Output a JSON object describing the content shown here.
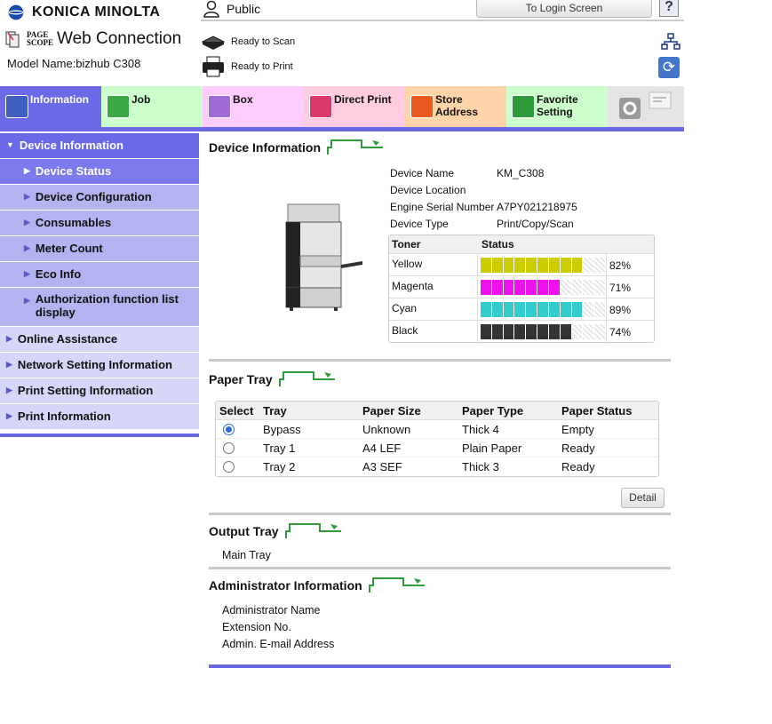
{
  "header": {
    "brand": "KONICA MINOLTA",
    "pagescope_top": "PAGE",
    "pagescope_bottom": "SCOPE",
    "product": "Web Connection",
    "model_label": "Model Name:bizhub C308",
    "user": "Public",
    "login_button": "To Login Screen",
    "help_label": "?",
    "status_scan": "Ready to Scan",
    "status_print": "Ready to Print"
  },
  "tabs": [
    {
      "label": "Information",
      "color": "#6b69e6",
      "icon_color": "#3e5fc0"
    },
    {
      "label": "Job",
      "color": "#ccffcc",
      "icon_color": "#3aa844"
    },
    {
      "label": "Box",
      "color": "#ffccff",
      "icon_color": "#a06ad8"
    },
    {
      "label": "Direct Print",
      "color": "#ffcce0",
      "icon_color": "#d83a6a"
    },
    {
      "label": "Store\nAddress",
      "color": "#ffd4a8",
      "icon_color": "#e85a20"
    },
    {
      "label": "Favorite\nSetting",
      "color": "#ccffcc",
      "icon_color": "#2f9a3a"
    }
  ],
  "sidebar": {
    "device_information": "Device Information",
    "device_status": "Device Status",
    "device_configuration": "Device Configuration",
    "consumables": "Consumables",
    "meter_count": "Meter Count",
    "eco_info": "Eco Info",
    "auth_list": "Authorization function list display",
    "online_assistance": "Online Assistance",
    "network_setting": "Network Setting Information",
    "print_setting": "Print Setting Information",
    "print_information": "Print Information"
  },
  "device_info": {
    "title": "Device Information",
    "rows": [
      {
        "key": "Device Name",
        "value": "KM_C308"
      },
      {
        "key": "Device Location",
        "value": ""
      },
      {
        "key": "Engine Serial Number",
        "value": "A7PY021218975"
      },
      {
        "key": "Device Type",
        "value": "Print/Copy/Scan"
      }
    ]
  },
  "toner": {
    "header_toner": "Toner",
    "header_status": "Status",
    "items": [
      {
        "name": "Yellow",
        "pct_label": "82%",
        "level": 0.82,
        "color": "#cccc00"
      },
      {
        "name": "Magenta",
        "pct_label": "71%",
        "level": 0.71,
        "color": "#ee11ee"
      },
      {
        "name": "Cyan",
        "pct_label": "89%",
        "level": 0.89,
        "color": "#33cccc"
      },
      {
        "name": "Black",
        "pct_label": "74%",
        "level": 0.74,
        "color": "#333333"
      }
    ]
  },
  "paper_tray": {
    "title": "Paper Tray",
    "headers": [
      "Select",
      "Tray",
      "Paper Size",
      "Paper Type",
      "Paper Status"
    ],
    "rows": [
      {
        "tray": "Bypass",
        "size": "Unknown",
        "type": "Thick 4",
        "status": "Empty",
        "selected": true
      },
      {
        "tray": "Tray 1",
        "size": "A4 LEF",
        "type": "Plain Paper",
        "status": "Ready",
        "selected": false
      },
      {
        "tray": "Tray 2",
        "size": "A3 SEF",
        "type": "Thick 3",
        "status": "Ready",
        "selected": false
      }
    ],
    "detail_button": "Detail"
  },
  "output_tray": {
    "title": "Output Tray",
    "value": "Main Tray"
  },
  "admin": {
    "title": "Administrator Information",
    "name_label": "Administrator Name",
    "ext_label": "Extension No.",
    "email_label": "Admin. E-mail Address"
  }
}
